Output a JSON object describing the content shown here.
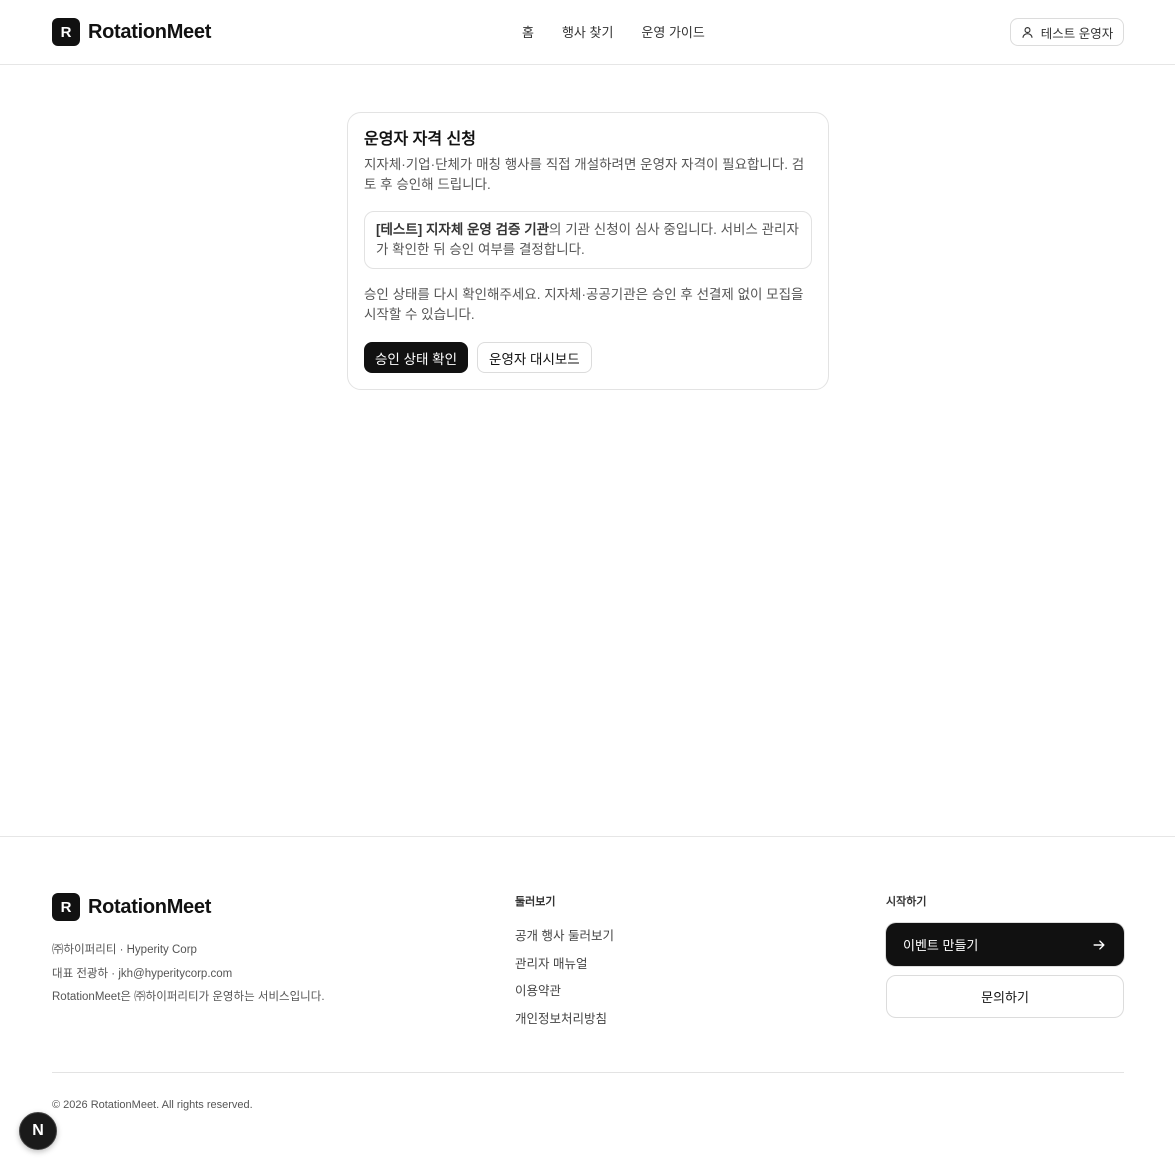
{
  "brand": {
    "mark": "R",
    "name": "RotationMeet"
  },
  "nav": {
    "items": [
      {
        "label": "홈"
      },
      {
        "label": "행사 찾기"
      },
      {
        "label": "운영 가이드"
      }
    ]
  },
  "user": {
    "label": "테스트 운영자",
    "icon": "user-icon"
  },
  "card": {
    "title": "운영자 자격 신청",
    "description": "지자체·기업·단체가 매칭 행사를 직접 개설하려면 운영자 자격이 필요합니다. 검토 후 승인해 드립니다.",
    "notice_org": "[테스트] 지자체 운영 검증 기관",
    "notice_text": "의 기관 신청이 심사 중입니다. 서비스 관리자가 확인한 뒤 승인 여부를 결정합니다.",
    "note": "승인 상태를 다시 확인해주세요. 지자체·공공기관은 승인 후 선결제 없이 모집을 시작할 수 있습니다.",
    "primary_button": "승인 상태 확인",
    "secondary_button": "운영자 대시보드"
  },
  "footer": {
    "company": "㈜하이퍼리티 · Hyperity Corp",
    "representative": "대표 전광하 · jkh@hyperitycorp.com",
    "tagline": "RotationMeet은 ㈜하이퍼리티가 운영하는 서비스입니다.",
    "browse": {
      "heading": "둘러보기",
      "links": [
        {
          "label": "공개 행사 둘러보기"
        },
        {
          "label": "관리자 매뉴얼"
        },
        {
          "label": "이용약관"
        },
        {
          "label": "개인정보처리방침"
        }
      ]
    },
    "start": {
      "heading": "시작하기",
      "create_event": "이벤트 만들기",
      "contact": "문의하기"
    },
    "copyright": "© 2026 RotationMeet. All rights reserved."
  },
  "dev_badge": {
    "label": "N"
  },
  "colors": {
    "primary": "#111111",
    "border": "#e3e3e3",
    "muted_text": "#555555"
  }
}
